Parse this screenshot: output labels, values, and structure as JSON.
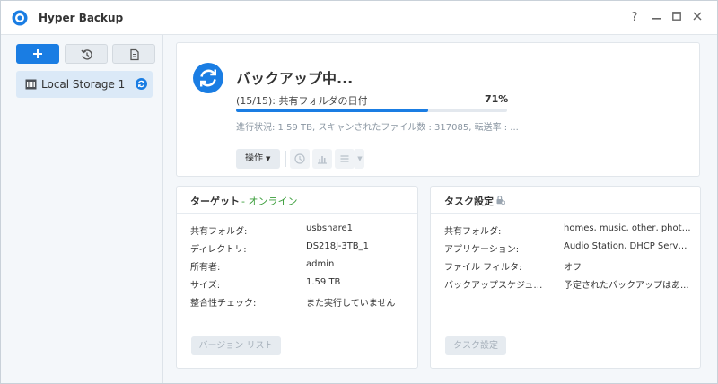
{
  "app": {
    "title": "Hyper Backup",
    "help_glyph": "?"
  },
  "sidebar": {
    "task_name": "Local Storage 1"
  },
  "status": {
    "title": "バックアップ中...",
    "subtitle": "(15/15): 共有フォルダの日付",
    "percent_text": "71%",
    "progress": 0.71,
    "detail": "進行状況: 1.59 TB, スキャンされたファイル数 : 317085, 転送率 : ...",
    "action_label": "操作"
  },
  "target": {
    "title": "ターゲット",
    "online": "- オンライン",
    "rows": [
      {
        "key": "共有フォルダ:",
        "value": "usbshare1"
      },
      {
        "key": "ディレクトリ:",
        "value": "DS218J-3TB_1"
      },
      {
        "key": "所有者:",
        "value": "admin"
      },
      {
        "key": "サイズ:",
        "value": "1.59 TB"
      },
      {
        "key": "整合性チェック:",
        "value": "また実行していません"
      }
    ],
    "button": "バージョン リスト"
  },
  "task": {
    "title": "タスク設定",
    "rows": [
      {
        "key": "共有フォルダ:",
        "value": "homes, music, other, photo..."
      },
      {
        "key": "アプリケーション:",
        "value": "Audio Station, DHCP Server..."
      },
      {
        "key": "ファイル フィルタ:",
        "value": "オフ"
      },
      {
        "key": "バックアップスケジュー...",
        "value": "予定されたバックアップはあ..."
      }
    ],
    "button": "タスク設定"
  },
  "colors": {
    "accent": "#1a7de3",
    "online": "#3a9d3a"
  },
  "icons": [
    "hyper-backup-app-icon",
    "plus-icon",
    "restore-clock-icon",
    "log-document-icon",
    "disk-icon",
    "sync-icon",
    "backup-sync-icon",
    "clock-icon",
    "chart-icon",
    "list-icon",
    "lock-icon"
  ]
}
